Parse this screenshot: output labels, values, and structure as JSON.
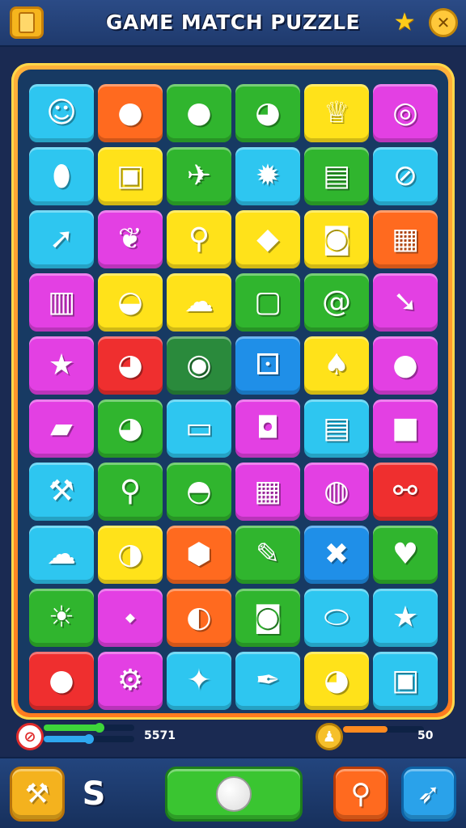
{
  "header": {
    "title": "GAME MATCH PUZZLE"
  },
  "board": {
    "rows": [
      [
        {
          "color": "#2ec6f0",
          "icon": "smiley-ball-icon",
          "glyph": "☺"
        },
        {
          "color": "#ff6a1f",
          "icon": "green-ball-icon",
          "glyph": "●"
        },
        {
          "color": "#30b52e",
          "icon": "red-ball-icon",
          "glyph": "●"
        },
        {
          "color": "#30b52e",
          "icon": "monkey-face-icon",
          "glyph": "◕"
        },
        {
          "color": "#ffe21a",
          "icon": "crowned-face-icon",
          "glyph": "♕"
        },
        {
          "color": "#e340e3",
          "icon": "lens-ring-icon",
          "glyph": "◎"
        }
      ],
      [
        {
          "color": "#2ec6f0",
          "icon": "rugby-ball-icon",
          "glyph": "⬮"
        },
        {
          "color": "#ffe21a",
          "icon": "picture-frame-icon",
          "glyph": "▣"
        },
        {
          "color": "#30b52e",
          "icon": "paper-plane-icon",
          "glyph": "✈"
        },
        {
          "color": "#2ec6f0",
          "icon": "gear-star-icon",
          "glyph": "✹"
        },
        {
          "color": "#30b52e",
          "icon": "book-icon",
          "glyph": "▤"
        },
        {
          "color": "#2ec6f0",
          "icon": "compass-icon",
          "glyph": "⊘"
        }
      ],
      [
        {
          "color": "#2ec6f0",
          "icon": "arrow-icon",
          "glyph": "➚"
        },
        {
          "color": "#e340e3",
          "icon": "leaf-icon",
          "glyph": "❦"
        },
        {
          "color": "#ffe21a",
          "icon": "magnifier-icon",
          "glyph": "⚲"
        },
        {
          "color": "#ffe21a",
          "icon": "gem-icon",
          "glyph": "◆"
        },
        {
          "color": "#ffe21a",
          "icon": "camera-box-icon",
          "glyph": "◙"
        },
        {
          "color": "#ff6a1f",
          "icon": "gift-box-icon",
          "glyph": "▦"
        }
      ],
      [
        {
          "color": "#e340e3",
          "icon": "notebook-icon",
          "glyph": "▥"
        },
        {
          "color": "#ffe21a",
          "icon": "red-creature-icon",
          "glyph": "◒"
        },
        {
          "color": "#ffe21a",
          "icon": "cloud-face-icon",
          "glyph": "☁"
        },
        {
          "color": "#30b52e",
          "icon": "screen-icon",
          "glyph": "▢"
        },
        {
          "color": "#30b52e",
          "icon": "snail-icon",
          "glyph": "@"
        },
        {
          "color": "#e340e3",
          "icon": "pin-icon",
          "glyph": "➘"
        }
      ],
      [
        {
          "color": "#e340e3",
          "icon": "star-flag-icon",
          "glyph": "★"
        },
        {
          "color": "#ef2f2f",
          "icon": "dog-face-icon",
          "glyph": "◕"
        },
        {
          "color": "#2a8a3c",
          "icon": "cookie-face-icon",
          "glyph": "◉"
        },
        {
          "color": "#1f8fe8",
          "icon": "robot-icon",
          "glyph": "⚀"
        },
        {
          "color": "#ffe21a",
          "icon": "bell-icon",
          "glyph": "♠"
        },
        {
          "color": "#e340e3",
          "icon": "purple-mirror-icon",
          "glyph": "●"
        }
      ],
      [
        {
          "color": "#e340e3",
          "icon": "green-box-icon",
          "glyph": "▰"
        },
        {
          "color": "#30b52e",
          "icon": "bear-face-icon",
          "glyph": "◕"
        },
        {
          "color": "#2ec6f0",
          "icon": "chest-icon",
          "glyph": "▭"
        },
        {
          "color": "#e340e3",
          "icon": "speaker-icon",
          "glyph": "◘"
        },
        {
          "color": "#2ec6f0",
          "icon": "scroll-icon",
          "glyph": "▤"
        },
        {
          "color": "#e340e3",
          "icon": "cube-icon",
          "glyph": "■"
        }
      ],
      [
        {
          "color": "#2ec6f0",
          "icon": "tools-icon",
          "glyph": "⚒"
        },
        {
          "color": "#30b52e",
          "icon": "search-icon",
          "glyph": "⚲"
        },
        {
          "color": "#30b52e",
          "icon": "egg-face-icon",
          "glyph": "◓"
        },
        {
          "color": "#e340e3",
          "icon": "box-icon",
          "glyph": "▦"
        },
        {
          "color": "#e340e3",
          "icon": "crystal-ball-icon",
          "glyph": "◍"
        },
        {
          "color": "#ef2f2f",
          "icon": "dumbbell-icon",
          "glyph": "⚯"
        }
      ],
      [
        {
          "color": "#2ec6f0",
          "icon": "cloud-icon",
          "glyph": "☁"
        },
        {
          "color": "#ffe21a",
          "icon": "beach-ball-icon",
          "glyph": "◑"
        },
        {
          "color": "#ff6a1f",
          "icon": "crystal-icon",
          "glyph": "⬢"
        },
        {
          "color": "#30b52e",
          "icon": "marker-icon",
          "glyph": "✎"
        },
        {
          "color": "#1f8fe8",
          "icon": "x-mark-icon",
          "glyph": "✖"
        },
        {
          "color": "#30b52e",
          "icon": "heart-icon",
          "glyph": "♥"
        }
      ],
      [
        {
          "color": "#30b52e",
          "icon": "sun-face-icon",
          "glyph": "☀"
        },
        {
          "color": "#e340e3",
          "icon": "feather-icon",
          "glyph": "⬩"
        },
        {
          "color": "#ff6a1f",
          "icon": "tape-roll-icon",
          "glyph": "◐"
        },
        {
          "color": "#30b52e",
          "icon": "camera-icon",
          "glyph": "◙"
        },
        {
          "color": "#2ec6f0",
          "icon": "oval-gem-icon",
          "glyph": "⬭"
        },
        {
          "color": "#2ec6f0",
          "icon": "star-pin-icon",
          "glyph": "★"
        }
      ],
      [
        {
          "color": "#ef2f2f",
          "icon": "apple-icon",
          "glyph": "●"
        },
        {
          "color": "#e340e3",
          "icon": "brush-icon",
          "glyph": "⚙"
        },
        {
          "color": "#2ec6f0",
          "icon": "cat-face-icon",
          "glyph": "✦"
        },
        {
          "color": "#2ec6f0",
          "icon": "pen-icon",
          "glyph": "✒"
        },
        {
          "color": "#ffe21a",
          "icon": "bubble-face-icon",
          "glyph": "◕"
        },
        {
          "color": "#2ec6f0",
          "icon": "photo-box-icon",
          "glyph": "▣"
        }
      ]
    ]
  },
  "progress": {
    "left_score": "5571",
    "right_score": "50",
    "left_bar_green": 0.62,
    "left_bar_blue": 0.5,
    "right_bar_orange": 0.55,
    "colors": {
      "green": "#3dd63a",
      "blue": "#2ea8f0",
      "orange": "#ff8a1f"
    }
  },
  "bottom": {
    "letter": "S"
  }
}
